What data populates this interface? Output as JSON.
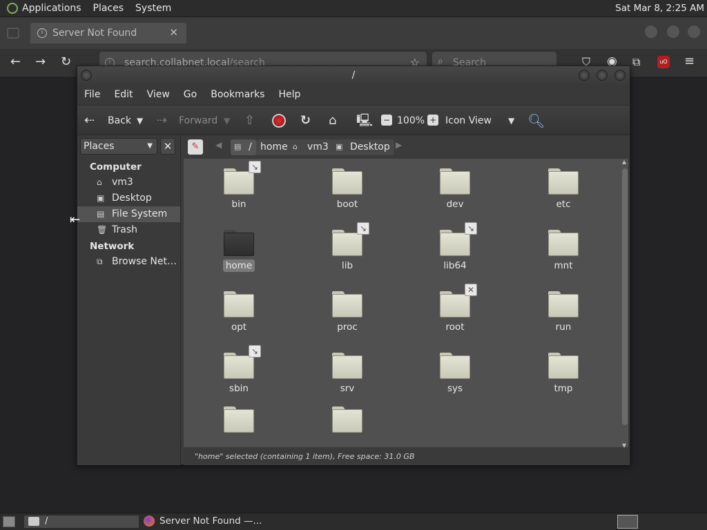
{
  "top_panel": {
    "menus": [
      "Applications",
      "Places",
      "System"
    ],
    "clock": "Sat Mar  8,  2:25 AM"
  },
  "browser": {
    "tab_title": "Server Not Found",
    "url_domain": "search.collabnet.local",
    "url_path": "/search",
    "search_placeholder": "Search"
  },
  "window": {
    "title": "/",
    "menu": [
      "File",
      "Edit",
      "View",
      "Go",
      "Bookmarks",
      "Help"
    ],
    "toolbar": {
      "back": "Back",
      "forward": "Forward",
      "zoom": "100%",
      "view_mode": "Icon View"
    },
    "sidebar": {
      "selector": "Places",
      "sections": [
        {
          "header": "Computer",
          "items": [
            "vm3",
            "Desktop",
            "File System",
            "Trash"
          ]
        },
        {
          "header": "Network",
          "items": [
            "Browse Net…"
          ]
        }
      ],
      "selected": "File System"
    },
    "breadcrumbs": [
      "/",
      "home",
      "vm3",
      "Desktop"
    ],
    "files": [
      {
        "name": "bin",
        "emblem": "symlink"
      },
      {
        "name": "boot",
        "emblem": ""
      },
      {
        "name": "dev",
        "emblem": ""
      },
      {
        "name": "etc",
        "emblem": ""
      },
      {
        "name": "home",
        "emblem": "",
        "selected": true
      },
      {
        "name": "lib",
        "emblem": "symlink"
      },
      {
        "name": "lib64",
        "emblem": "symlink"
      },
      {
        "name": "mnt",
        "emblem": ""
      },
      {
        "name": "opt",
        "emblem": ""
      },
      {
        "name": "proc",
        "emblem": ""
      },
      {
        "name": "root",
        "emblem": "no-access"
      },
      {
        "name": "run",
        "emblem": ""
      },
      {
        "name": "sbin",
        "emblem": "symlink"
      },
      {
        "name": "srv",
        "emblem": ""
      },
      {
        "name": "sys",
        "emblem": ""
      },
      {
        "name": "tmp",
        "emblem": ""
      },
      {
        "name": "",
        "emblem": ""
      },
      {
        "name": "",
        "emblem": ""
      }
    ],
    "status": "\"home\" selected (containing 1 item), Free space: 31.0 GB"
  },
  "taskbar": {
    "items": [
      "/",
      "Server Not Found —..."
    ]
  }
}
